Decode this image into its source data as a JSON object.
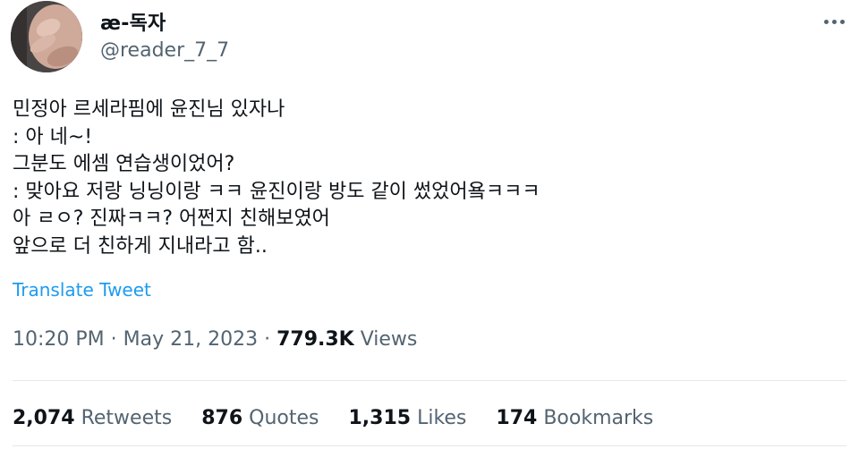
{
  "user": {
    "display_name": "æ-독자",
    "handle": "@reader_7_7"
  },
  "tweet": {
    "lines": [
      "민정아 르세라핌에 윤진님 있자나",
      ": 아 네~!",
      "그분도 에셈 연습생이었어?",
      ": 맞아요 저랑 닝닝이랑 ㅋㅋ 윤진이랑 방도 같이 썼었어욬ㅋㅋㅋ",
      "아 ㄹㅇ? 진짜ㅋㅋ? 어쩐지 친해보였어",
      "앞으로 더 친하게 지내라고 함.."
    ],
    "translate_label": "Translate Tweet"
  },
  "meta": {
    "time": "10:20 PM",
    "separator": " · ",
    "date": "May 21, 2023",
    "views_count": "779.3K",
    "views_label": " Views"
  },
  "stats": {
    "retweets_count": "2,074",
    "retweets_label": " Retweets",
    "quotes_count": "876",
    "quotes_label": " Quotes",
    "likes_count": "1,315",
    "likes_label": " Likes",
    "bookmarks_count": "174",
    "bookmarks_label": " Bookmarks"
  },
  "icons": {
    "more": "more-horizontal-icon"
  },
  "colors": {
    "text": "#0f1419",
    "secondary": "#536471",
    "link": "#1d9bf0",
    "divider": "#e3e8ec"
  }
}
